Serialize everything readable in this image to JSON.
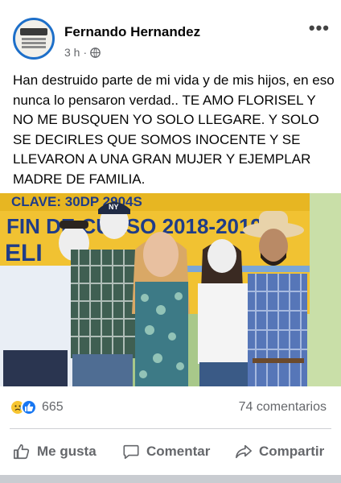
{
  "post": {
    "author": "Fernando Hernandez",
    "time": "3 h",
    "separator": "·",
    "more_label": "•••",
    "text": "Han destruido parte de mi vida y de mis hijos, en eso nunca lo pensaron verdad.. TE AMO FLORISEL Y NO ME BUSQUEN YO SOLO LLEGARE. Y SOLO SE DECIRLES QUE SOMOS INOCENTE Y SE LLEVARON A UNA GRAN MUJER Y EJEMPLAR MADRE DE FAMILIA."
  },
  "photo": {
    "banner_line1": "CLAVE: 30DP  2904S",
    "banner_line2": "FIN DE CURSO 2018-2019",
    "banner_line3": "ELI",
    "cap_text": "NY"
  },
  "stats": {
    "reaction_count": "665",
    "comments_label": "74 comentarios"
  },
  "actions": {
    "like_label": "Me gusta",
    "comment_label": "Comentar",
    "share_label": "Compartir"
  },
  "colors": {
    "like_blue": "#1877f2",
    "sad_yellow": "#f7c531",
    "secondary_text": "#65676b",
    "banner_yellow": "#f1c232"
  }
}
